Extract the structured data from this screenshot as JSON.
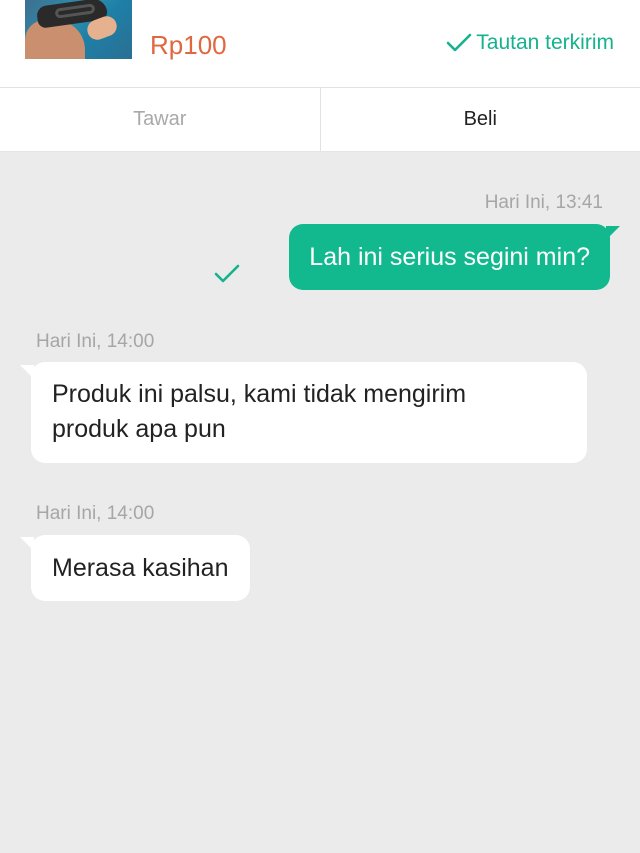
{
  "product": {
    "price": "Rp100",
    "link_status": "Tautan terkirim"
  },
  "tabs": {
    "offer": "Tawar",
    "buy": "Beli"
  },
  "messages": [
    {
      "timestamp": "Hari Ini, 13:41",
      "direction": "outgoing",
      "text": "Lah ini serius segini min?",
      "read": true
    },
    {
      "timestamp": "Hari Ini, 14:00",
      "direction": "incoming",
      "text": "Produk ini palsu, kami tidak mengirim produk apa pun"
    },
    {
      "timestamp": "Hari Ini, 14:00",
      "direction": "incoming",
      "text": "Merasa kasihan"
    }
  ],
  "colors": {
    "accent": "#12b98f",
    "price": "#e0673f",
    "background": "#ebebeb"
  },
  "icons": {
    "status": "check-icon",
    "read_receipt": "check-icon"
  }
}
